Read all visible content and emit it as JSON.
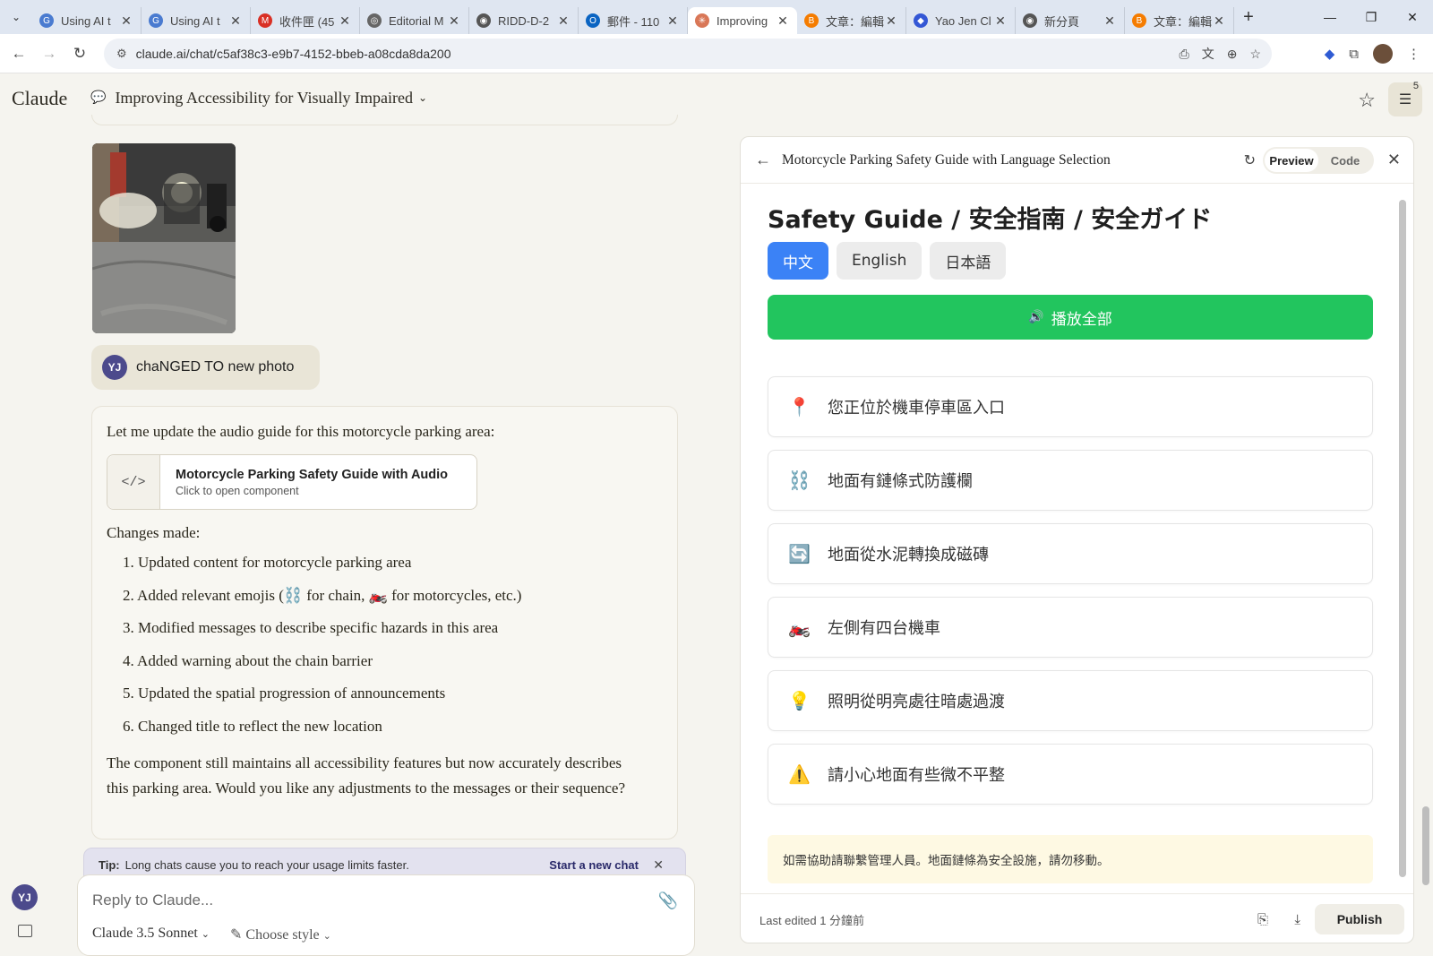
{
  "browser": {
    "tabs": [
      {
        "title": "Using AI t",
        "color": "#4a7bd0",
        "glyph": "G"
      },
      {
        "title": "Using AI t",
        "color": "#4a7bd0",
        "glyph": "G"
      },
      {
        "title": "收件匣 (45",
        "color": "#d93025",
        "glyph": "M"
      },
      {
        "title": "Editorial M",
        "color": "#666666",
        "glyph": "◎"
      },
      {
        "title": "RIDD-D-2",
        "color": "#555555",
        "glyph": "◉"
      },
      {
        "title": "郵件 - 110",
        "color": "#0a64c2",
        "glyph": "O"
      },
      {
        "title": "Improving",
        "color": "#d97757",
        "glyph": "✳"
      },
      {
        "title": "文章：編輯",
        "color": "#f57c00",
        "glyph": "B"
      },
      {
        "title": "Yao Jen Cl",
        "color": "#3457d5",
        "glyph": "◆"
      },
      {
        "title": "新分頁",
        "color": "#555555",
        "glyph": "◉"
      },
      {
        "title": "文章：編輯",
        "color": "#f57c00",
        "glyph": "B"
      }
    ],
    "active_tab_index": 6,
    "url": "claude.ai/chat/c5af38c3-e9b7-4152-bbeb-a08cda8da200"
  },
  "header": {
    "brand": "Claude",
    "chat_title": "Improving Accessibility for Visually Impaired",
    "badge_count": "5"
  },
  "chat": {
    "user_message": "chaNGED TO new photo",
    "user_initials": "YJ",
    "assistant_intro": "Let me update the audio guide for this motorcycle parking area:",
    "artifact_card": {
      "title": "Motorcycle Parking Safety Guide with Audio",
      "subtitle": "Click to open component",
      "icon": "</>"
    },
    "changes_label": "Changes made:",
    "changes": [
      "1. Updated content for motorcycle parking area",
      "2. Added relevant emojis (⛓️ for chain, 🏍️ for motorcycles, etc.)",
      "3. Modified messages to describe specific hazards in this area",
      "4. Added warning about the chain barrier",
      "5. Updated the spatial progression of announcements",
      "6. Changed title to reflect the new location"
    ],
    "outro": "The component still maintains all accessibility features but now accurately describes this parking area. Would you like any adjustments to the messages or their sequence?"
  },
  "tip": {
    "label": "Tip:",
    "text": "Long chats cause you to reach your usage limits faster.",
    "action": "Start a new chat"
  },
  "composer": {
    "placeholder": "Reply to Claude...",
    "model": "Claude 3.5 Sonnet",
    "style": "Choose style"
  },
  "panel": {
    "title": "Motorcycle Parking Safety Guide with Language Selection",
    "preview_label": "Preview",
    "code_label": "Code",
    "guide_title": "Safety Guide / 安全指南 / 安全ガイド",
    "languages": [
      "中文",
      "English",
      "日本語"
    ],
    "selected_language": "中文",
    "play_all": "播放全部",
    "messages": [
      {
        "icon": "📍",
        "text": "您正位於機車停車區入口"
      },
      {
        "icon": "⛓️",
        "text": "地面有鏈條式防護欄"
      },
      {
        "icon": "🔄",
        "text": "地面從水泥轉換成磁磚"
      },
      {
        "icon": "🏍️",
        "text": "左側有四台機車"
      },
      {
        "icon": "💡",
        "text": "照明從明亮處往暗處過渡"
      },
      {
        "icon": "⚠️",
        "text": "請小心地面有些微不平整"
      }
    ],
    "note": "如需協助請聯繫管理人員。地面鏈條為安全設施，請勿移動。",
    "last_edited": "Last edited 1 分鐘前",
    "publish": "Publish"
  },
  "colors": {
    "accent_blue": "#3b82f6",
    "play_green": "#22c55e",
    "note_bg": "#fef9e3",
    "avatar": "#4c4a8c"
  }
}
